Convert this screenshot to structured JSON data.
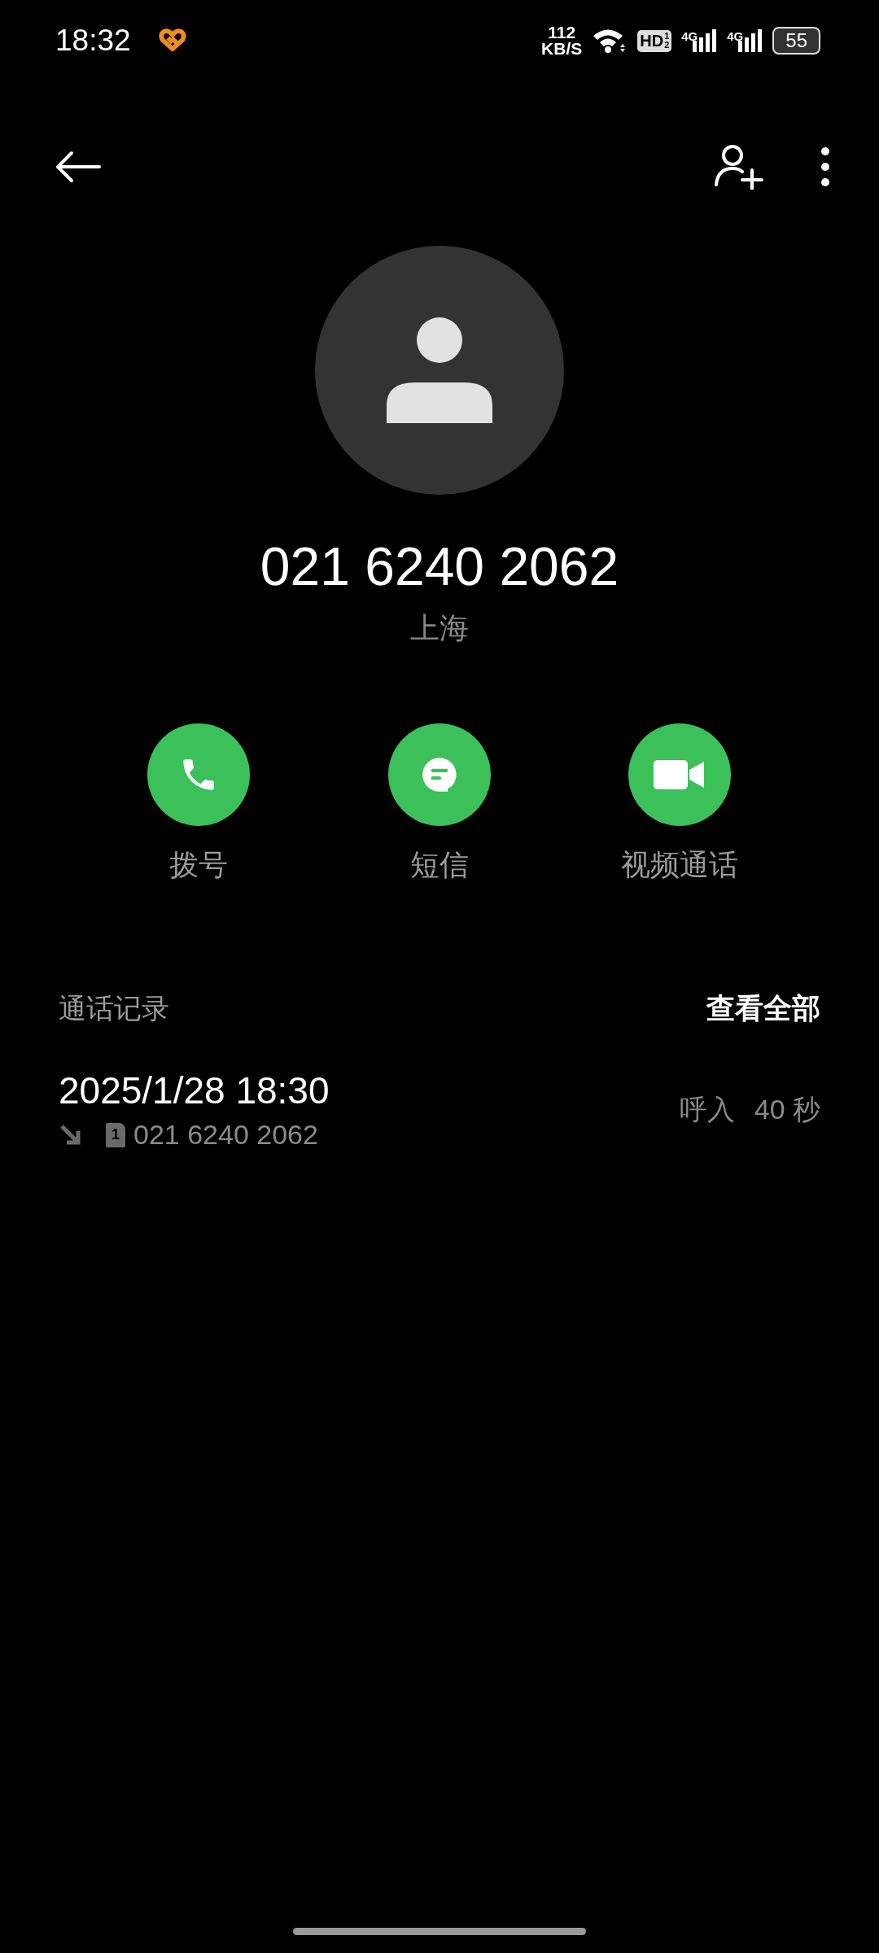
{
  "status_bar": {
    "time": "18:32",
    "speed_value": "112",
    "speed_unit": "KB/S",
    "hd_badge": "HD",
    "hd_slots": [
      "1",
      "2"
    ],
    "networks": [
      "4G",
      "4G"
    ],
    "battery": "55"
  },
  "contact": {
    "number": "021 6240 2062",
    "location": "上海"
  },
  "actions": [
    {
      "kind": "call",
      "label": "拨号"
    },
    {
      "kind": "message",
      "label": "短信"
    },
    {
      "kind": "video",
      "label": "视频通话"
    }
  ],
  "call_log": {
    "title": "通话记录",
    "view_all": "查看全部",
    "entries": [
      {
        "datetime": "2025/1/28 18:30",
        "incoming": true,
        "sim": "1",
        "number": "021 6240 2062",
        "type": "呼入",
        "duration": "40 秒"
      }
    ]
  }
}
